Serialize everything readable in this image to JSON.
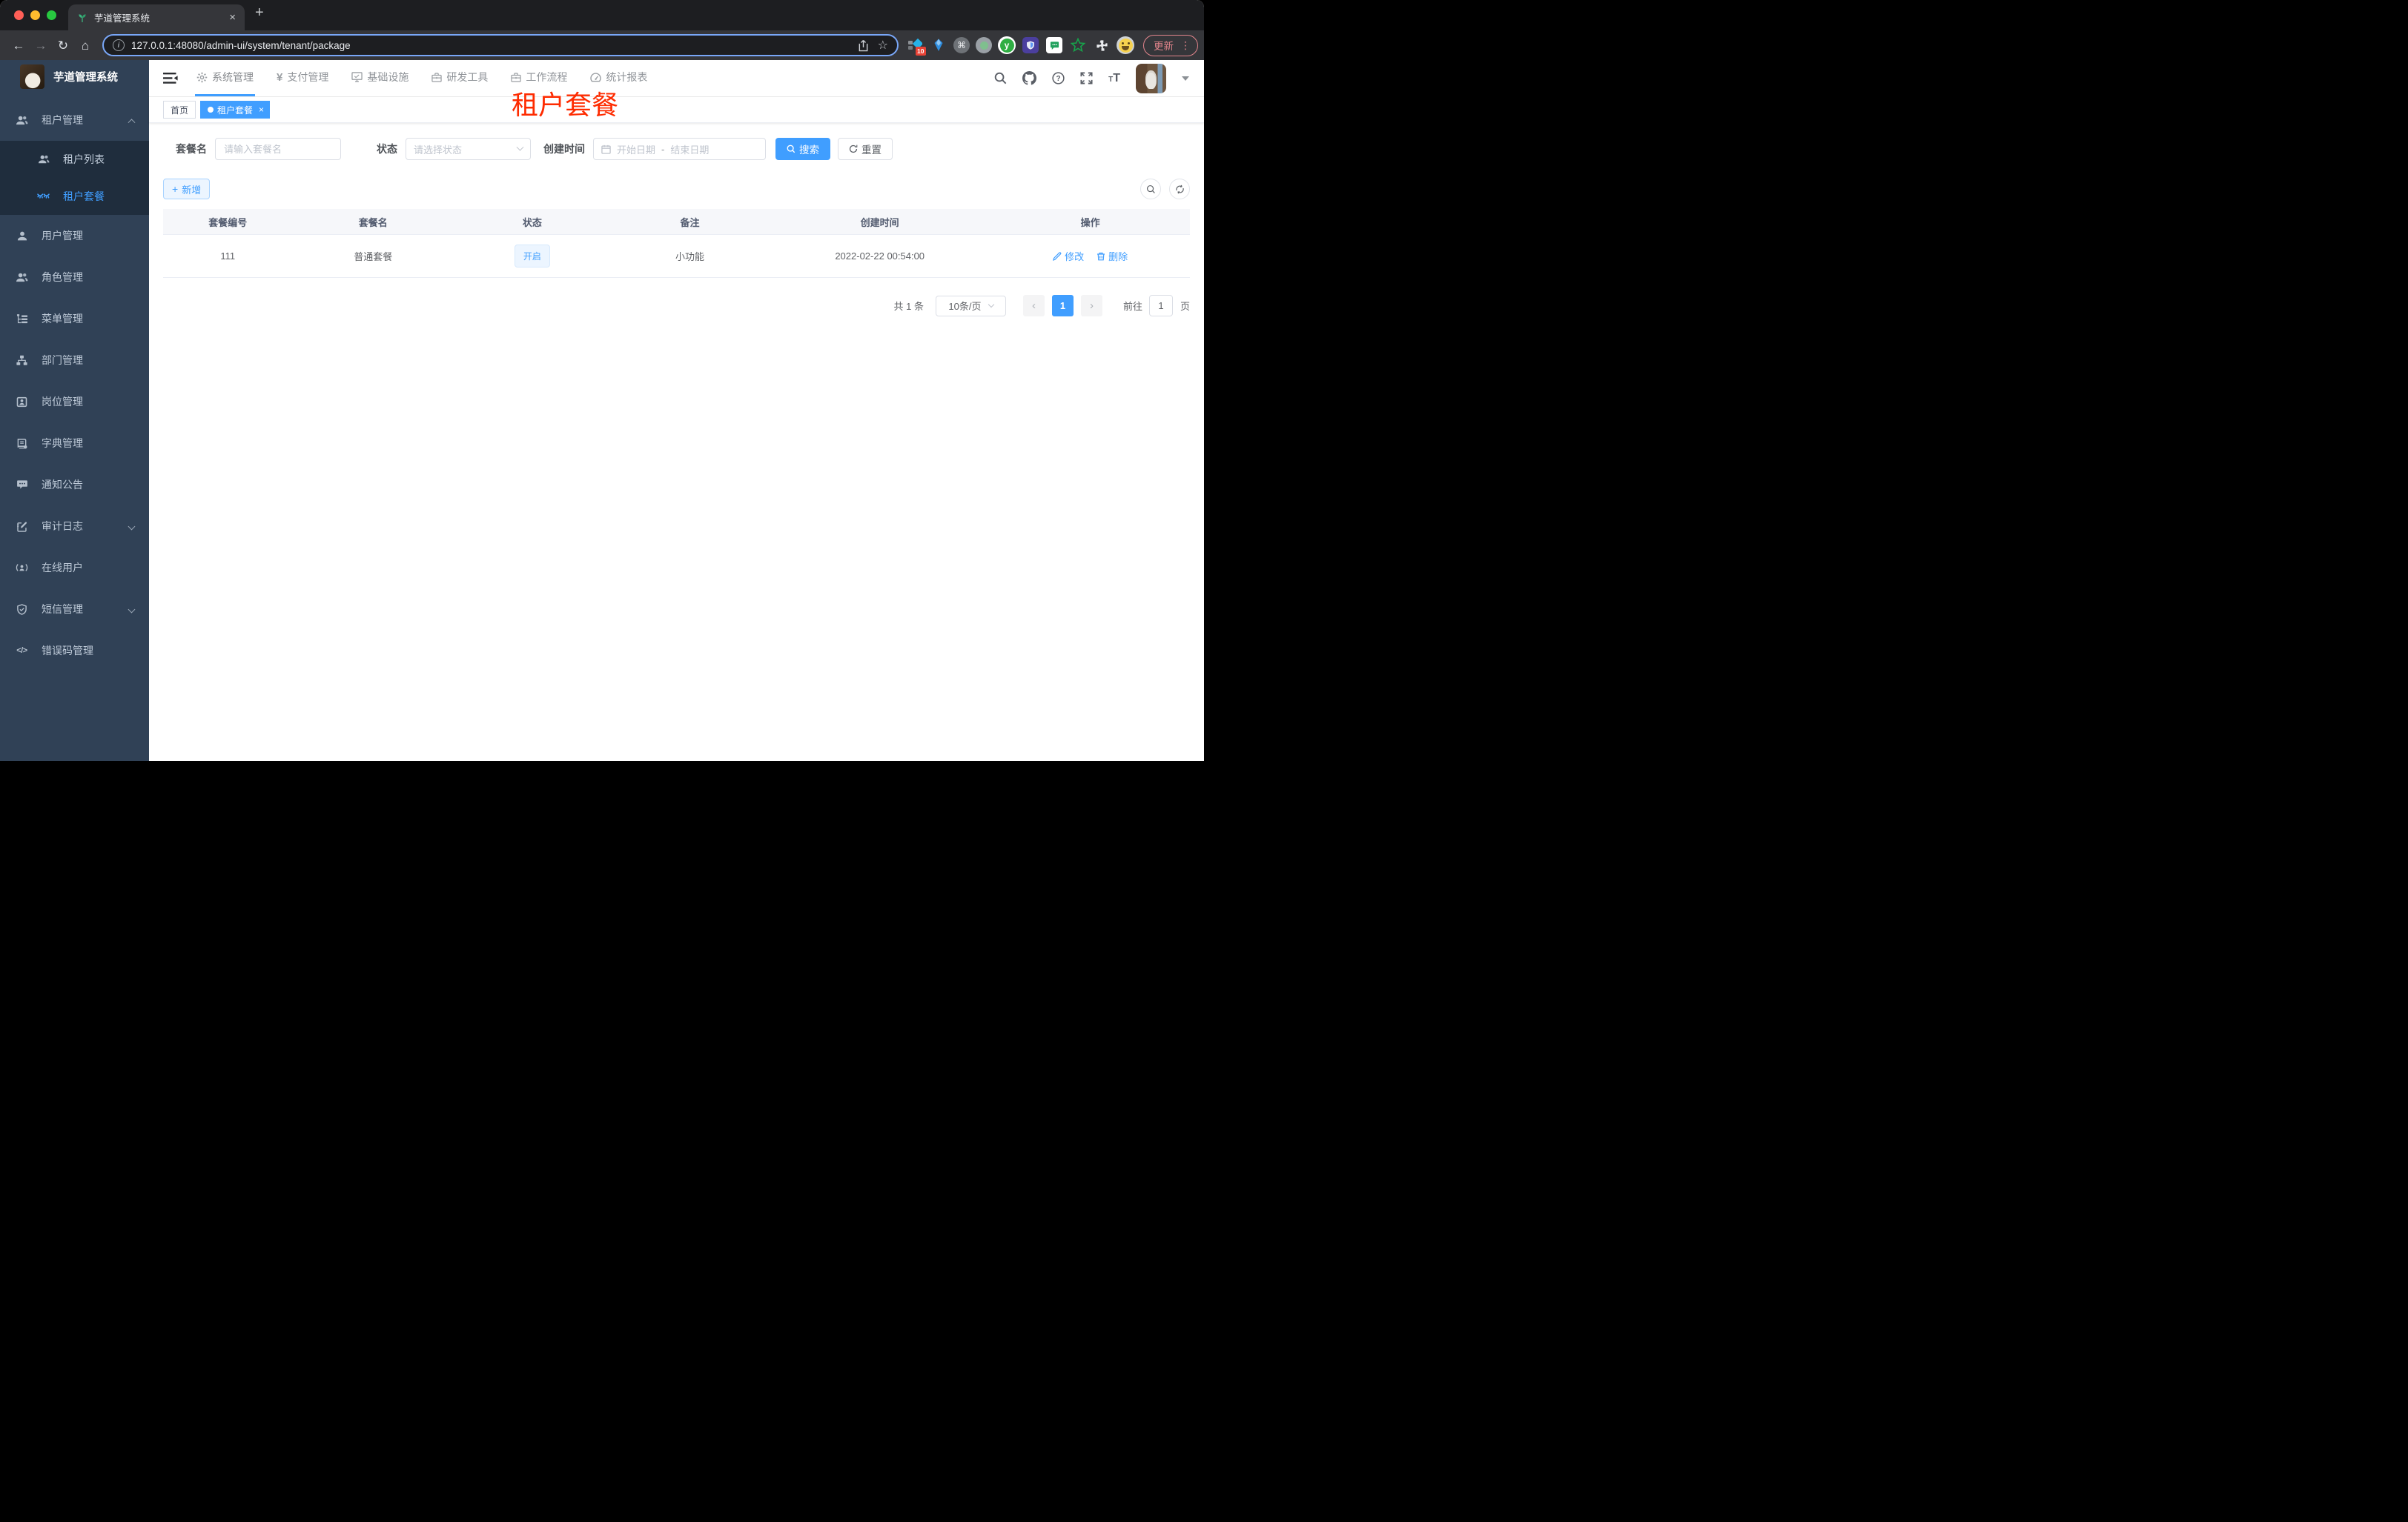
{
  "colors": {
    "primary": "#409eff",
    "overlay_red": "#fe2b00",
    "sidebar_bg": "#304156"
  },
  "browser": {
    "tab_title": "芋道管理系统",
    "url": "127.0.0.1:48080/admin-ui/system/tenant/package",
    "extension_badge": "10",
    "update_label": "更新"
  },
  "app": {
    "logo_title": "芋道管理系统",
    "nav": {
      "items": [
        {
          "label": "系统管理"
        },
        {
          "label": "支付管理"
        },
        {
          "label": "基础设施"
        },
        {
          "label": "研发工具"
        },
        {
          "label": "工作流程"
        },
        {
          "label": "统计报表"
        }
      ]
    },
    "sidebar": {
      "items": [
        {
          "label": "租户管理"
        },
        {
          "label": "租户列表"
        },
        {
          "label": "租户套餐"
        },
        {
          "label": "用户管理"
        },
        {
          "label": "角色管理"
        },
        {
          "label": "菜单管理"
        },
        {
          "label": "部门管理"
        },
        {
          "label": "岗位管理"
        },
        {
          "label": "字典管理"
        },
        {
          "label": "通知公告"
        },
        {
          "label": "审计日志"
        },
        {
          "label": "在线用户"
        },
        {
          "label": "短信管理"
        },
        {
          "label": "错误码管理"
        }
      ]
    },
    "tags": {
      "home": "首页",
      "active": "租户套餐"
    },
    "overlay_title": "租户套餐",
    "filters": {
      "name_label": "套餐名",
      "name_placeholder": "请输入套餐名",
      "status_label": "状态",
      "status_placeholder": "请选择状态",
      "date_label": "创建时间",
      "date_start": "开始日期",
      "date_sep": "-",
      "date_end": "结束日期",
      "search": "搜索",
      "reset": "重置",
      "add": "新增"
    },
    "table": {
      "headers": [
        "套餐编号",
        "套餐名",
        "状态",
        "备注",
        "创建时间",
        "操作"
      ],
      "row": {
        "id": "111",
        "name": "普通套餐",
        "status": "开启",
        "remark": "小功能",
        "created": "2022-02-22 00:54:00"
      },
      "actions": {
        "edit": "修改",
        "delete": "删除"
      }
    },
    "pagination": {
      "total": "共 1 条",
      "size": "10条/页",
      "page": "1",
      "goto": "前往",
      "goto_value": "1",
      "unit": "页"
    }
  }
}
